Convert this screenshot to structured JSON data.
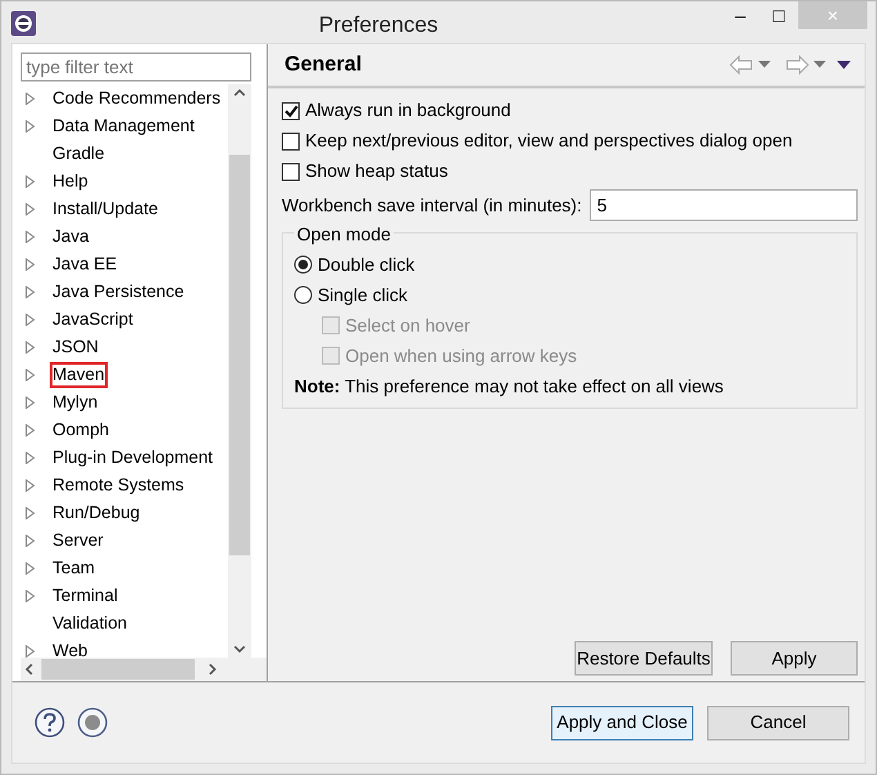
{
  "window": {
    "title": "Preferences",
    "controls": [
      "–",
      "□",
      "×"
    ]
  },
  "filter": {
    "placeholder": "type filter text"
  },
  "tree": [
    {
      "label": "Code Recommenders",
      "expandable": true,
      "highlighted": false
    },
    {
      "label": "Data Management",
      "expandable": true,
      "highlighted": false
    },
    {
      "label": "Gradle",
      "expandable": false,
      "highlighted": false
    },
    {
      "label": "Help",
      "expandable": true,
      "highlighted": false
    },
    {
      "label": "Install/Update",
      "expandable": true,
      "highlighted": false
    },
    {
      "label": "Java",
      "expandable": true,
      "highlighted": false
    },
    {
      "label": "Java EE",
      "expandable": true,
      "highlighted": false
    },
    {
      "label": "Java Persistence",
      "expandable": true,
      "highlighted": false
    },
    {
      "label": "JavaScript",
      "expandable": true,
      "highlighted": false
    },
    {
      "label": "JSON",
      "expandable": true,
      "highlighted": false
    },
    {
      "label": "Maven",
      "expandable": true,
      "highlighted": true
    },
    {
      "label": "Mylyn",
      "expandable": true,
      "highlighted": false
    },
    {
      "label": "Oomph",
      "expandable": true,
      "highlighted": false
    },
    {
      "label": "Plug-in Development",
      "expandable": true,
      "highlighted": false
    },
    {
      "label": "Remote Systems",
      "expandable": true,
      "highlighted": false
    },
    {
      "label": "Run/Debug",
      "expandable": true,
      "highlighted": false
    },
    {
      "label": "Server",
      "expandable": true,
      "highlighted": false
    },
    {
      "label": "Team",
      "expandable": true,
      "highlighted": false
    },
    {
      "label": "Terminal",
      "expandable": true,
      "highlighted": false
    },
    {
      "label": "Validation",
      "expandable": false,
      "highlighted": false
    },
    {
      "label": "Web",
      "expandable": true,
      "highlighted": false
    }
  ],
  "page": {
    "title": "General",
    "options": [
      {
        "label": "Always run in background",
        "checked": true
      },
      {
        "label": "Keep next/previous editor, view and perspectives dialog open",
        "checked": false
      },
      {
        "label": "Show heap status",
        "checked": false
      }
    ],
    "save_interval": {
      "label": "Workbench save interval (in minutes):",
      "value": "5"
    },
    "open_mode": {
      "title": "Open mode",
      "radios": [
        {
          "label": "Double click",
          "selected": true
        },
        {
          "label": "Single click",
          "selected": false
        }
      ],
      "sub_options": [
        {
          "label": "Select on hover",
          "checked": false,
          "disabled": true
        },
        {
          "label": "Open when using arrow keys",
          "checked": false,
          "disabled": true
        }
      ],
      "note": "**Note:** This preference may not take effect on all views"
    },
    "buttons": [
      "Restore Defaults",
      "Apply"
    ]
  },
  "footer": {
    "buttons": [
      {
        "label": "Apply and Close",
        "default": true
      },
      {
        "label": "Cancel",
        "default": false
      }
    ]
  }
}
